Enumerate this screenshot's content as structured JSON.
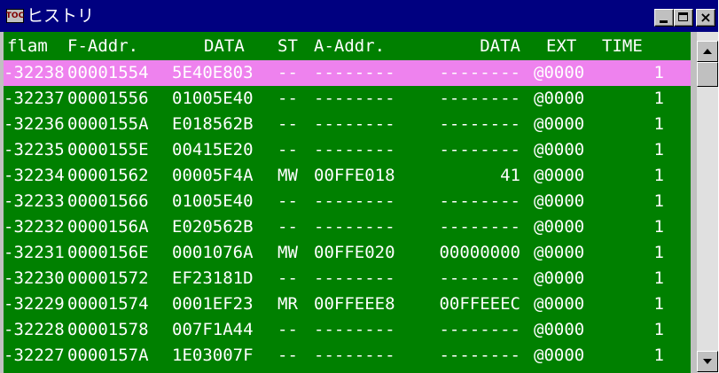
{
  "window": {
    "title": "ヒストリ",
    "app_icon_text": "TOC"
  },
  "columns": [
    "flam",
    "F-Addr.",
    "DATA",
    "ST",
    "A-Addr.",
    "DATA",
    "EXT",
    "TIME"
  ],
  "rows": [
    {
      "flam": "-32238",
      "faddr": "00001554",
      "data": "5E40E803",
      "st": "--",
      "aaddr": "--------",
      "data2": "--------",
      "ext": "@0000",
      "time": "1",
      "selected": true
    },
    {
      "flam": "-32237",
      "faddr": "00001556",
      "data": "01005E40",
      "st": "--",
      "aaddr": "--------",
      "data2": "--------",
      "ext": "@0000",
      "time": "1"
    },
    {
      "flam": "-32236",
      "faddr": "0000155A",
      "data": "E018562B",
      "st": "--",
      "aaddr": "--------",
      "data2": "--------",
      "ext": "@0000",
      "time": "1"
    },
    {
      "flam": "-32235",
      "faddr": "0000155E",
      "data": "00415E20",
      "st": "--",
      "aaddr": "--------",
      "data2": "--------",
      "ext": "@0000",
      "time": "1"
    },
    {
      "flam": "-32234",
      "faddr": "00001562",
      "data": "00005F4A",
      "st": "MW",
      "aaddr": "00FFE018",
      "data2": "41",
      "ext": "@0000",
      "time": "1"
    },
    {
      "flam": "-32233",
      "faddr": "00001566",
      "data": "01005E40",
      "st": "--",
      "aaddr": "--------",
      "data2": "--------",
      "ext": "@0000",
      "time": "1"
    },
    {
      "flam": "-32232",
      "faddr": "0000156A",
      "data": "E020562B",
      "st": "--",
      "aaddr": "--------",
      "data2": "--------",
      "ext": "@0000",
      "time": "1"
    },
    {
      "flam": "-32231",
      "faddr": "0000156E",
      "data": "0001076A",
      "st": "MW",
      "aaddr": "00FFE020",
      "data2": "00000000",
      "ext": "@0000",
      "time": "1"
    },
    {
      "flam": "-32230",
      "faddr": "00001572",
      "data": "EF23181D",
      "st": "--",
      "aaddr": "--------",
      "data2": "--------",
      "ext": "@0000",
      "time": "1"
    },
    {
      "flam": "-32229",
      "faddr": "00001574",
      "data": "0001EF23",
      "st": "MR",
      "aaddr": "00FFEEE8",
      "data2": "00FFEEEC",
      "ext": "@0000",
      "time": "1"
    },
    {
      "flam": "-32228",
      "faddr": "00001578",
      "data": "007F1A44",
      "st": "--",
      "aaddr": "--------",
      "data2": "--------",
      "ext": "@0000",
      "time": "1"
    },
    {
      "flam": "-32227",
      "faddr": "0000157A",
      "data": "1E03007F",
      "st": "--",
      "aaddr": "--------",
      "data2": "--------",
      "ext": "@0000",
      "time": "1"
    }
  ],
  "colors": {
    "title_bar": "#000080",
    "list_background": "#008000",
    "selected_row": "#ee82ee",
    "text": "#ffffff"
  }
}
